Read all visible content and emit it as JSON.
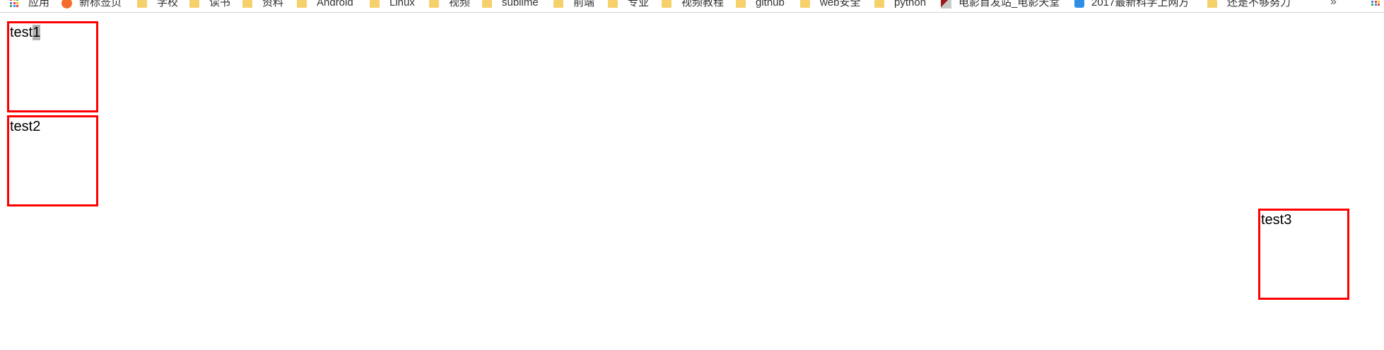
{
  "bookmarks_bar": {
    "items": [
      {
        "label": "应用",
        "icon": "apps-icon"
      },
      {
        "label": "新标签页",
        "icon": "orange-logo-icon"
      },
      {
        "label": "学校",
        "icon": "folder-icon"
      },
      {
        "label": "读书",
        "icon": "folder-icon"
      },
      {
        "label": "资料",
        "icon": "folder-icon"
      },
      {
        "label": "Android",
        "icon": "folder-icon"
      },
      {
        "label": "Linux",
        "icon": "folder-icon"
      },
      {
        "label": "视频",
        "icon": "folder-icon"
      },
      {
        "label": "sublime",
        "icon": "folder-icon"
      },
      {
        "label": "前端",
        "icon": "folder-icon"
      },
      {
        "label": "专业",
        "icon": "folder-icon"
      },
      {
        "label": "视频教程",
        "icon": "folder-icon"
      },
      {
        "label": "github",
        "icon": "folder-icon"
      },
      {
        "label": "web安全",
        "icon": "folder-icon"
      },
      {
        "label": "python",
        "icon": "folder-icon"
      },
      {
        "label": "电影首发站_电影天堂",
        "icon": "movie-site-icon"
      },
      {
        "label": "2017最新科学上网方",
        "icon": "blue-site-icon"
      },
      {
        "label": "还是不够努力",
        "icon": "folder-icon"
      }
    ],
    "overflow_label": "»"
  },
  "boxes": [
    {
      "text_main": "test",
      "text_selected": "1"
    },
    {
      "text": "test2"
    },
    {
      "text": "test3"
    }
  ],
  "colors": {
    "box_border": "#ff0000",
    "folder": "#f6d16b",
    "selection": "#b3b3b3"
  }
}
